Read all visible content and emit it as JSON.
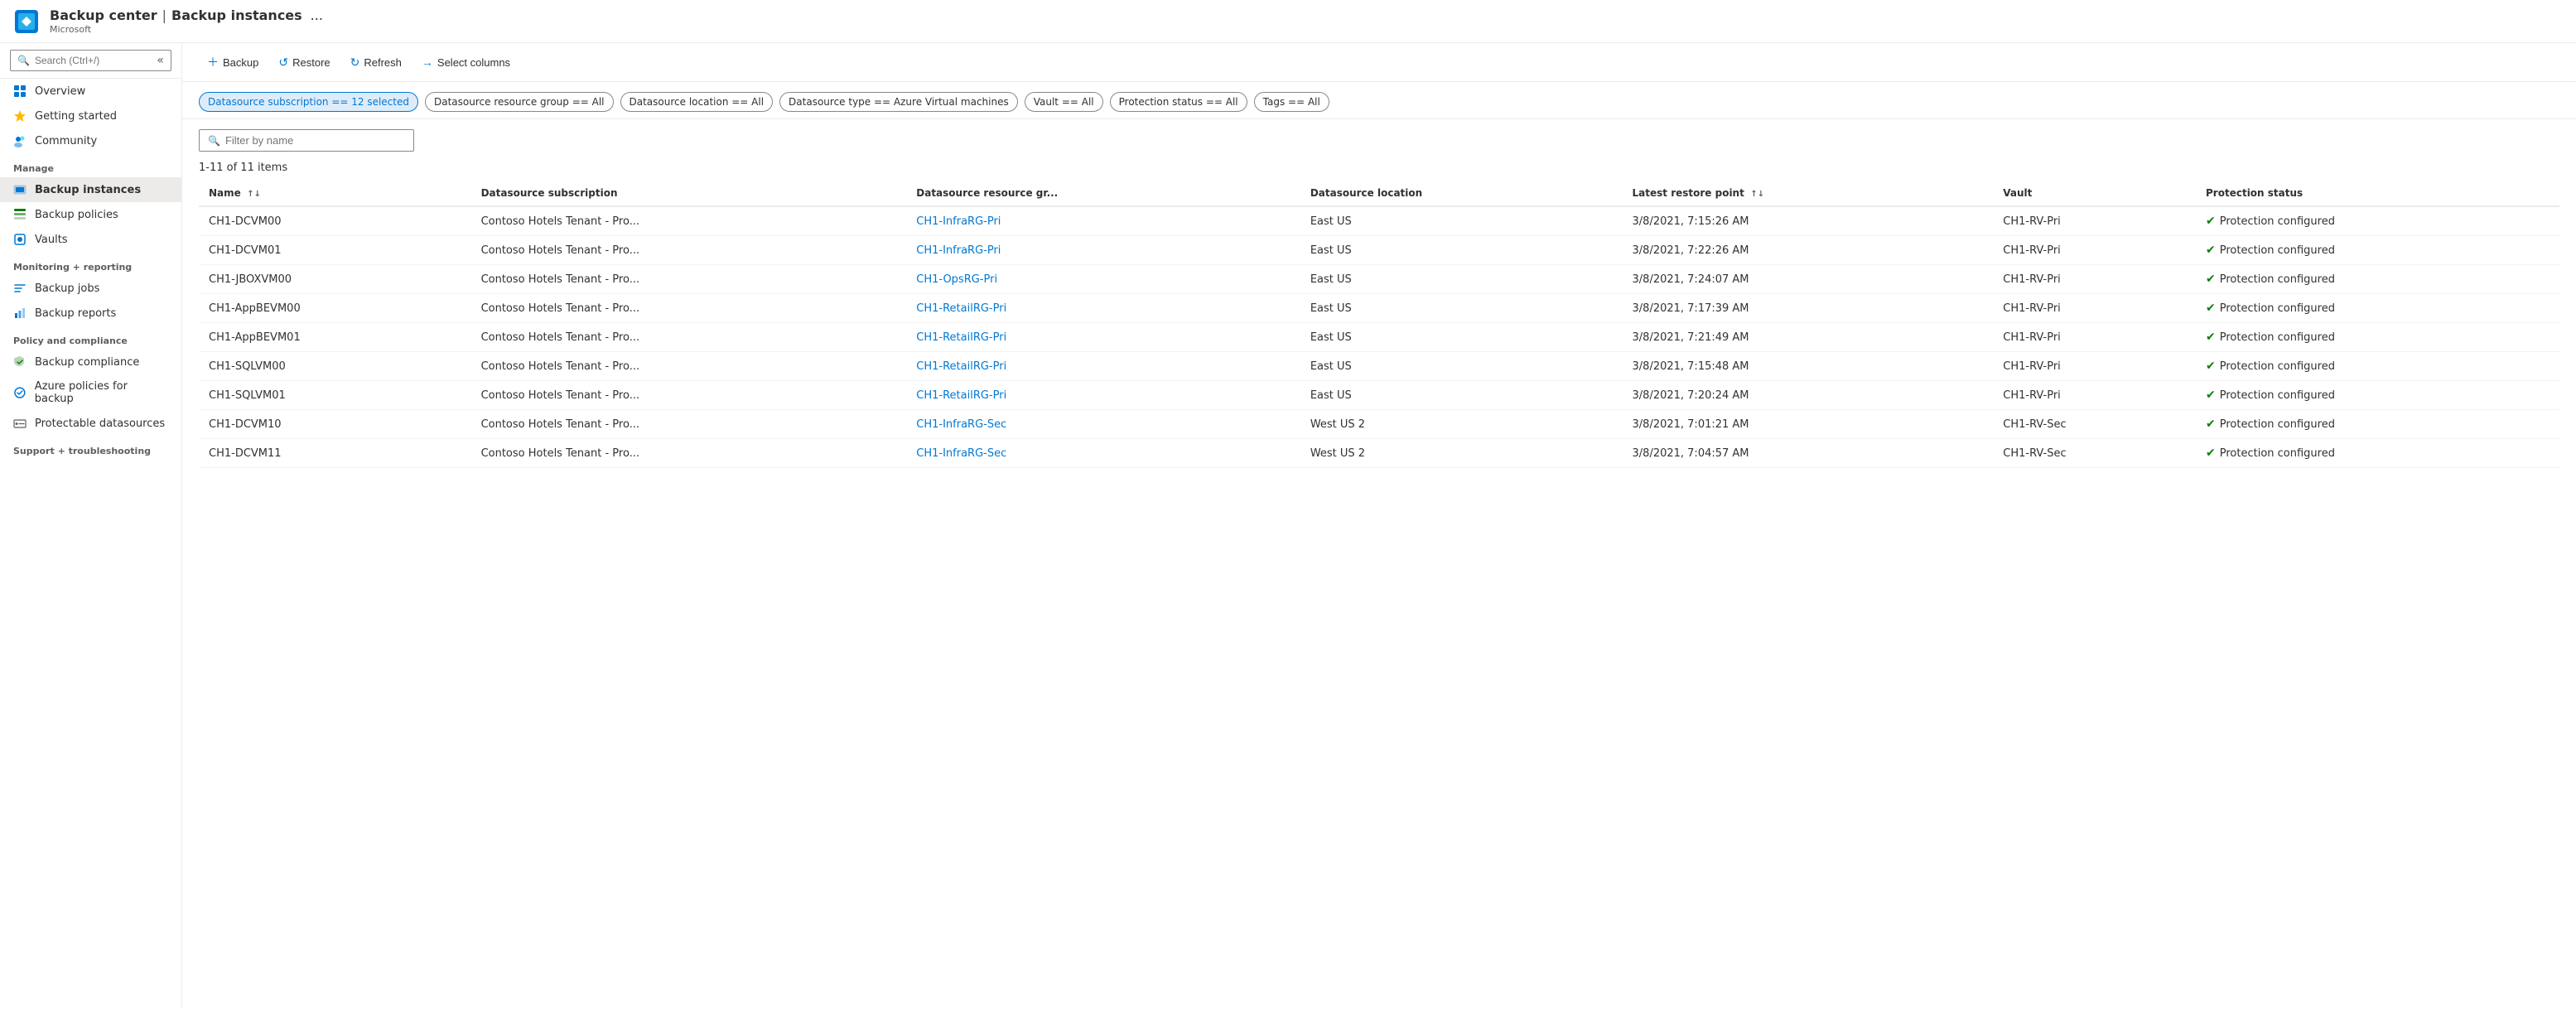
{
  "header": {
    "app_icon_alt": "Backup center icon",
    "app_name": "Backup center",
    "divider": "|",
    "page_title": "Backup instances",
    "microsoft_label": "Microsoft",
    "more_label": "..."
  },
  "sidebar": {
    "search_placeholder": "Search (Ctrl+/)",
    "collapse_icon": "«",
    "nav_items": [
      {
        "id": "overview",
        "label": "Overview",
        "icon": "overview"
      },
      {
        "id": "getting-started",
        "label": "Getting started",
        "icon": "getting-started"
      },
      {
        "id": "community",
        "label": "Community",
        "icon": "community"
      }
    ],
    "manage_label": "Manage",
    "manage_items": [
      {
        "id": "backup-instances",
        "label": "Backup instances",
        "icon": "backup-instances",
        "active": true
      },
      {
        "id": "backup-policies",
        "label": "Backup policies",
        "icon": "backup-policies"
      },
      {
        "id": "vaults",
        "label": "Vaults",
        "icon": "vaults"
      }
    ],
    "monitoring_label": "Monitoring + reporting",
    "monitoring_items": [
      {
        "id": "backup-jobs",
        "label": "Backup jobs",
        "icon": "backup-jobs"
      },
      {
        "id": "backup-reports",
        "label": "Backup reports",
        "icon": "backup-reports"
      }
    ],
    "policy_label": "Policy and compliance",
    "policy_items": [
      {
        "id": "backup-compliance",
        "label": "Backup compliance",
        "icon": "backup-compliance"
      },
      {
        "id": "azure-policies",
        "label": "Azure policies for backup",
        "icon": "azure-policies"
      },
      {
        "id": "protectable-datasources",
        "label": "Protectable datasources",
        "icon": "protectable-datasources"
      }
    ],
    "support_label": "Support + troubleshooting"
  },
  "toolbar": {
    "backup_label": "Backup",
    "restore_label": "Restore",
    "refresh_label": "Refresh",
    "select_columns_label": "Select columns"
  },
  "filters": [
    {
      "id": "datasource-subscription",
      "label": "Datasource subscription == 12 selected",
      "active": true
    },
    {
      "id": "datasource-resource-group",
      "label": "Datasource resource group == All",
      "active": false
    },
    {
      "id": "datasource-location",
      "label": "Datasource location == All",
      "active": false
    },
    {
      "id": "datasource-type",
      "label": "Datasource type == Azure Virtual machines",
      "active": false
    },
    {
      "id": "vault",
      "label": "Vault == All",
      "active": false
    },
    {
      "id": "protection-status",
      "label": "Protection status == All",
      "active": false
    },
    {
      "id": "tags",
      "label": "Tags == All",
      "active": false
    }
  ],
  "search": {
    "placeholder": "Filter by name"
  },
  "items_count": "1-11 of 11 items",
  "table": {
    "columns": [
      {
        "id": "name",
        "label": "Name",
        "sortable": true
      },
      {
        "id": "datasource-subscription",
        "label": "Datasource subscription",
        "sortable": false
      },
      {
        "id": "datasource-resource-group",
        "label": "Datasource resource gr...",
        "sortable": false
      },
      {
        "id": "datasource-location",
        "label": "Datasource location",
        "sortable": false
      },
      {
        "id": "latest-restore-point",
        "label": "Latest restore point",
        "sortable": true
      },
      {
        "id": "vault",
        "label": "Vault",
        "sortable": false
      },
      {
        "id": "protection-status",
        "label": "Protection status",
        "sortable": false
      }
    ],
    "rows": [
      {
        "name": "CH1-DCVM00",
        "datasource_subscription": "Contoso Hotels Tenant - Pro...",
        "datasource_resource_group": "CH1-InfraRG-Pri",
        "datasource_location": "East US",
        "latest_restore_point": "3/8/2021, 7:15:26 AM",
        "vault": "CH1-RV-Pri",
        "protection_status": "Protection configured"
      },
      {
        "name": "CH1-DCVM01",
        "datasource_subscription": "Contoso Hotels Tenant - Pro...",
        "datasource_resource_group": "CH1-InfraRG-Pri",
        "datasource_location": "East US",
        "latest_restore_point": "3/8/2021, 7:22:26 AM",
        "vault": "CH1-RV-Pri",
        "protection_status": "Protection configured"
      },
      {
        "name": "CH1-JBOXVM00",
        "datasource_subscription": "Contoso Hotels Tenant - Pro...",
        "datasource_resource_group": "CH1-OpsRG-Pri",
        "datasource_location": "East US",
        "latest_restore_point": "3/8/2021, 7:24:07 AM",
        "vault": "CH1-RV-Pri",
        "protection_status": "Protection configured"
      },
      {
        "name": "CH1-AppBEVM00",
        "datasource_subscription": "Contoso Hotels Tenant - Pro...",
        "datasource_resource_group": "CH1-RetailRG-Pri",
        "datasource_location": "East US",
        "latest_restore_point": "3/8/2021, 7:17:39 AM",
        "vault": "CH1-RV-Pri",
        "protection_status": "Protection configured"
      },
      {
        "name": "CH1-AppBEVM01",
        "datasource_subscription": "Contoso Hotels Tenant - Pro...",
        "datasource_resource_group": "CH1-RetailRG-Pri",
        "datasource_location": "East US",
        "latest_restore_point": "3/8/2021, 7:21:49 AM",
        "vault": "CH1-RV-Pri",
        "protection_status": "Protection configured"
      },
      {
        "name": "CH1-SQLVM00",
        "datasource_subscription": "Contoso Hotels Tenant - Pro...",
        "datasource_resource_group": "CH1-RetailRG-Pri",
        "datasource_location": "East US",
        "latest_restore_point": "3/8/2021, 7:15:48 AM",
        "vault": "CH1-RV-Pri",
        "protection_status": "Protection configured"
      },
      {
        "name": "CH1-SQLVM01",
        "datasource_subscription": "Contoso Hotels Tenant - Pro...",
        "datasource_resource_group": "CH1-RetailRG-Pri",
        "datasource_location": "East US",
        "latest_restore_point": "3/8/2021, 7:20:24 AM",
        "vault": "CH1-RV-Pri",
        "protection_status": "Protection configured"
      },
      {
        "name": "CH1-DCVM10",
        "datasource_subscription": "Contoso Hotels Tenant - Pro...",
        "datasource_resource_group": "CH1-InfraRG-Sec",
        "datasource_location": "West US 2",
        "latest_restore_point": "3/8/2021, 7:01:21 AM",
        "vault": "CH1-RV-Sec",
        "protection_status": "Protection configured"
      },
      {
        "name": "CH1-DCVM11",
        "datasource_subscription": "Contoso Hotels Tenant - Pro...",
        "datasource_resource_group": "CH1-InfraRG-Sec",
        "datasource_location": "West US 2",
        "latest_restore_point": "3/8/2021, 7:04:57 AM",
        "vault": "CH1-RV-Sec",
        "protection_status": "Protection configured"
      }
    ]
  }
}
